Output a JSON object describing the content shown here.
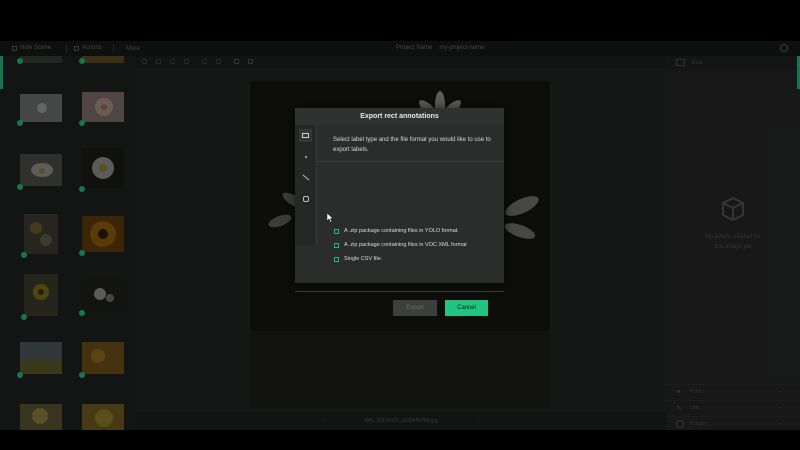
{
  "topbar": {
    "hide_scene_label": "Hide Scene",
    "actions_label": "Actions",
    "more_label": "More",
    "project_label": "Project Name",
    "project_name": "my-project-name"
  },
  "image_nav": {
    "filename": "IMG_20190101_0123456789.jpg",
    "prev_glyph": "‹",
    "next_glyph": "›"
  },
  "right_panel": {
    "header_label": "Rect",
    "empty_line1": "No labels created for",
    "empty_line2": "this image yet",
    "rows": [
      {
        "label": "Point"
      },
      {
        "label": "Line"
      },
      {
        "label": "Polygon"
      }
    ]
  },
  "modal": {
    "title": "Export rect annotations",
    "description": "Select label type and the file format you would like to use to export labels.",
    "options": [
      {
        "label": "A .zip package containing files in YOLO format."
      },
      {
        "label": "A .zip package containing files in VOC XML format"
      },
      {
        "label": "Single CSV file."
      }
    ],
    "export_label": "Export",
    "cancel_label": "Cancel",
    "tabs": [
      "rect-tab-icon",
      "point-tab-icon",
      "line-tab-icon",
      "polygon-tab-icon"
    ]
  },
  "colors": {
    "accent": "#21c582",
    "dot": "#1fb779"
  }
}
